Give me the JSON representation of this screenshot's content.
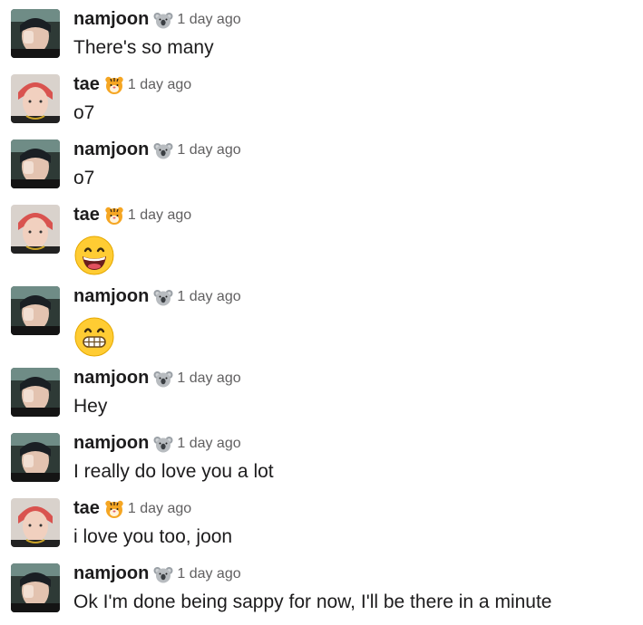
{
  "colors": {
    "name": "#1d1c1d",
    "timestamp": "#616061",
    "text": "#1d1c1d"
  },
  "users": {
    "namjoon": {
      "name": "namjoon",
      "badge_icon": "koala-emoji-icon",
      "avatar": "namjoon-avatar"
    },
    "tae": {
      "name": "tae",
      "badge_icon": "tiger-emoji-icon",
      "avatar": "tae-avatar"
    }
  },
  "messages": [
    {
      "author": "namjoon",
      "time": "1 day ago",
      "text": "There's so many"
    },
    {
      "author": "tae",
      "time": "1 day ago",
      "text": "o7"
    },
    {
      "author": "namjoon",
      "time": "1 day ago",
      "text": "o7"
    },
    {
      "author": "tae",
      "time": "1 day ago",
      "emoji": "grinning-face-emoji-icon"
    },
    {
      "author": "namjoon",
      "time": "1 day ago",
      "emoji": "grimacing-face-emoji-icon"
    },
    {
      "author": "namjoon",
      "time": "1 day ago",
      "text": "Hey"
    },
    {
      "author": "namjoon",
      "time": "1 day ago",
      "text": "I really do love you a lot"
    },
    {
      "author": "tae",
      "time": "1 day ago",
      "text": "i love you too, joon"
    },
    {
      "author": "namjoon",
      "time": "1 day ago",
      "text": "Ok I'm done being sappy for now, I'll be there in a minute"
    }
  ]
}
